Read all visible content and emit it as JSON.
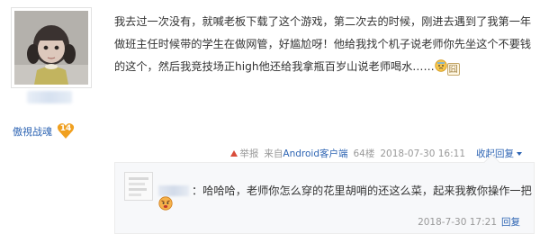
{
  "author": {
    "grade_title": "傲視战魂",
    "level": "14"
  },
  "post": {
    "body": "我去过一次没有，就喊老板下载了这个游戏，第二次去的时候，刚进去遇到了我第一年做班主任时候带的学生在做网管，好尴尬呀！他给我找个机子说老师你先坐这个不要钱的这个，然后我竞技场正high他还给我拿瓶百岁山说老师喝水……",
    "emoji_jiong": "囧"
  },
  "meta": {
    "report": "举报",
    "source_prefix": "来自",
    "source_link": "Android客户端",
    "floor": "64楼",
    "time": "2018-07-30 16:11",
    "reply_toggle": "收起回复"
  },
  "reply": {
    "text": "：哈哈哈，老师你怎么穿的花里胡哨的还这么菜，起来我教你操作一把",
    "time": "2018-7-30 17:21",
    "reply_link": "回复"
  },
  "icons": {
    "avatar": "girl-avatar-image",
    "level_badge": "heart-badge-icon",
    "emoji_1": "sweat-face-emoji",
    "emoji_2": "jiong-emoji",
    "emoji_3": "angry-face-emoji",
    "report": "report-triangle-icon",
    "toggle": "caret-down-icon"
  },
  "colors": {
    "link": "#2d64b3",
    "badge": "#f0a020",
    "meta_text": "#999999"
  }
}
